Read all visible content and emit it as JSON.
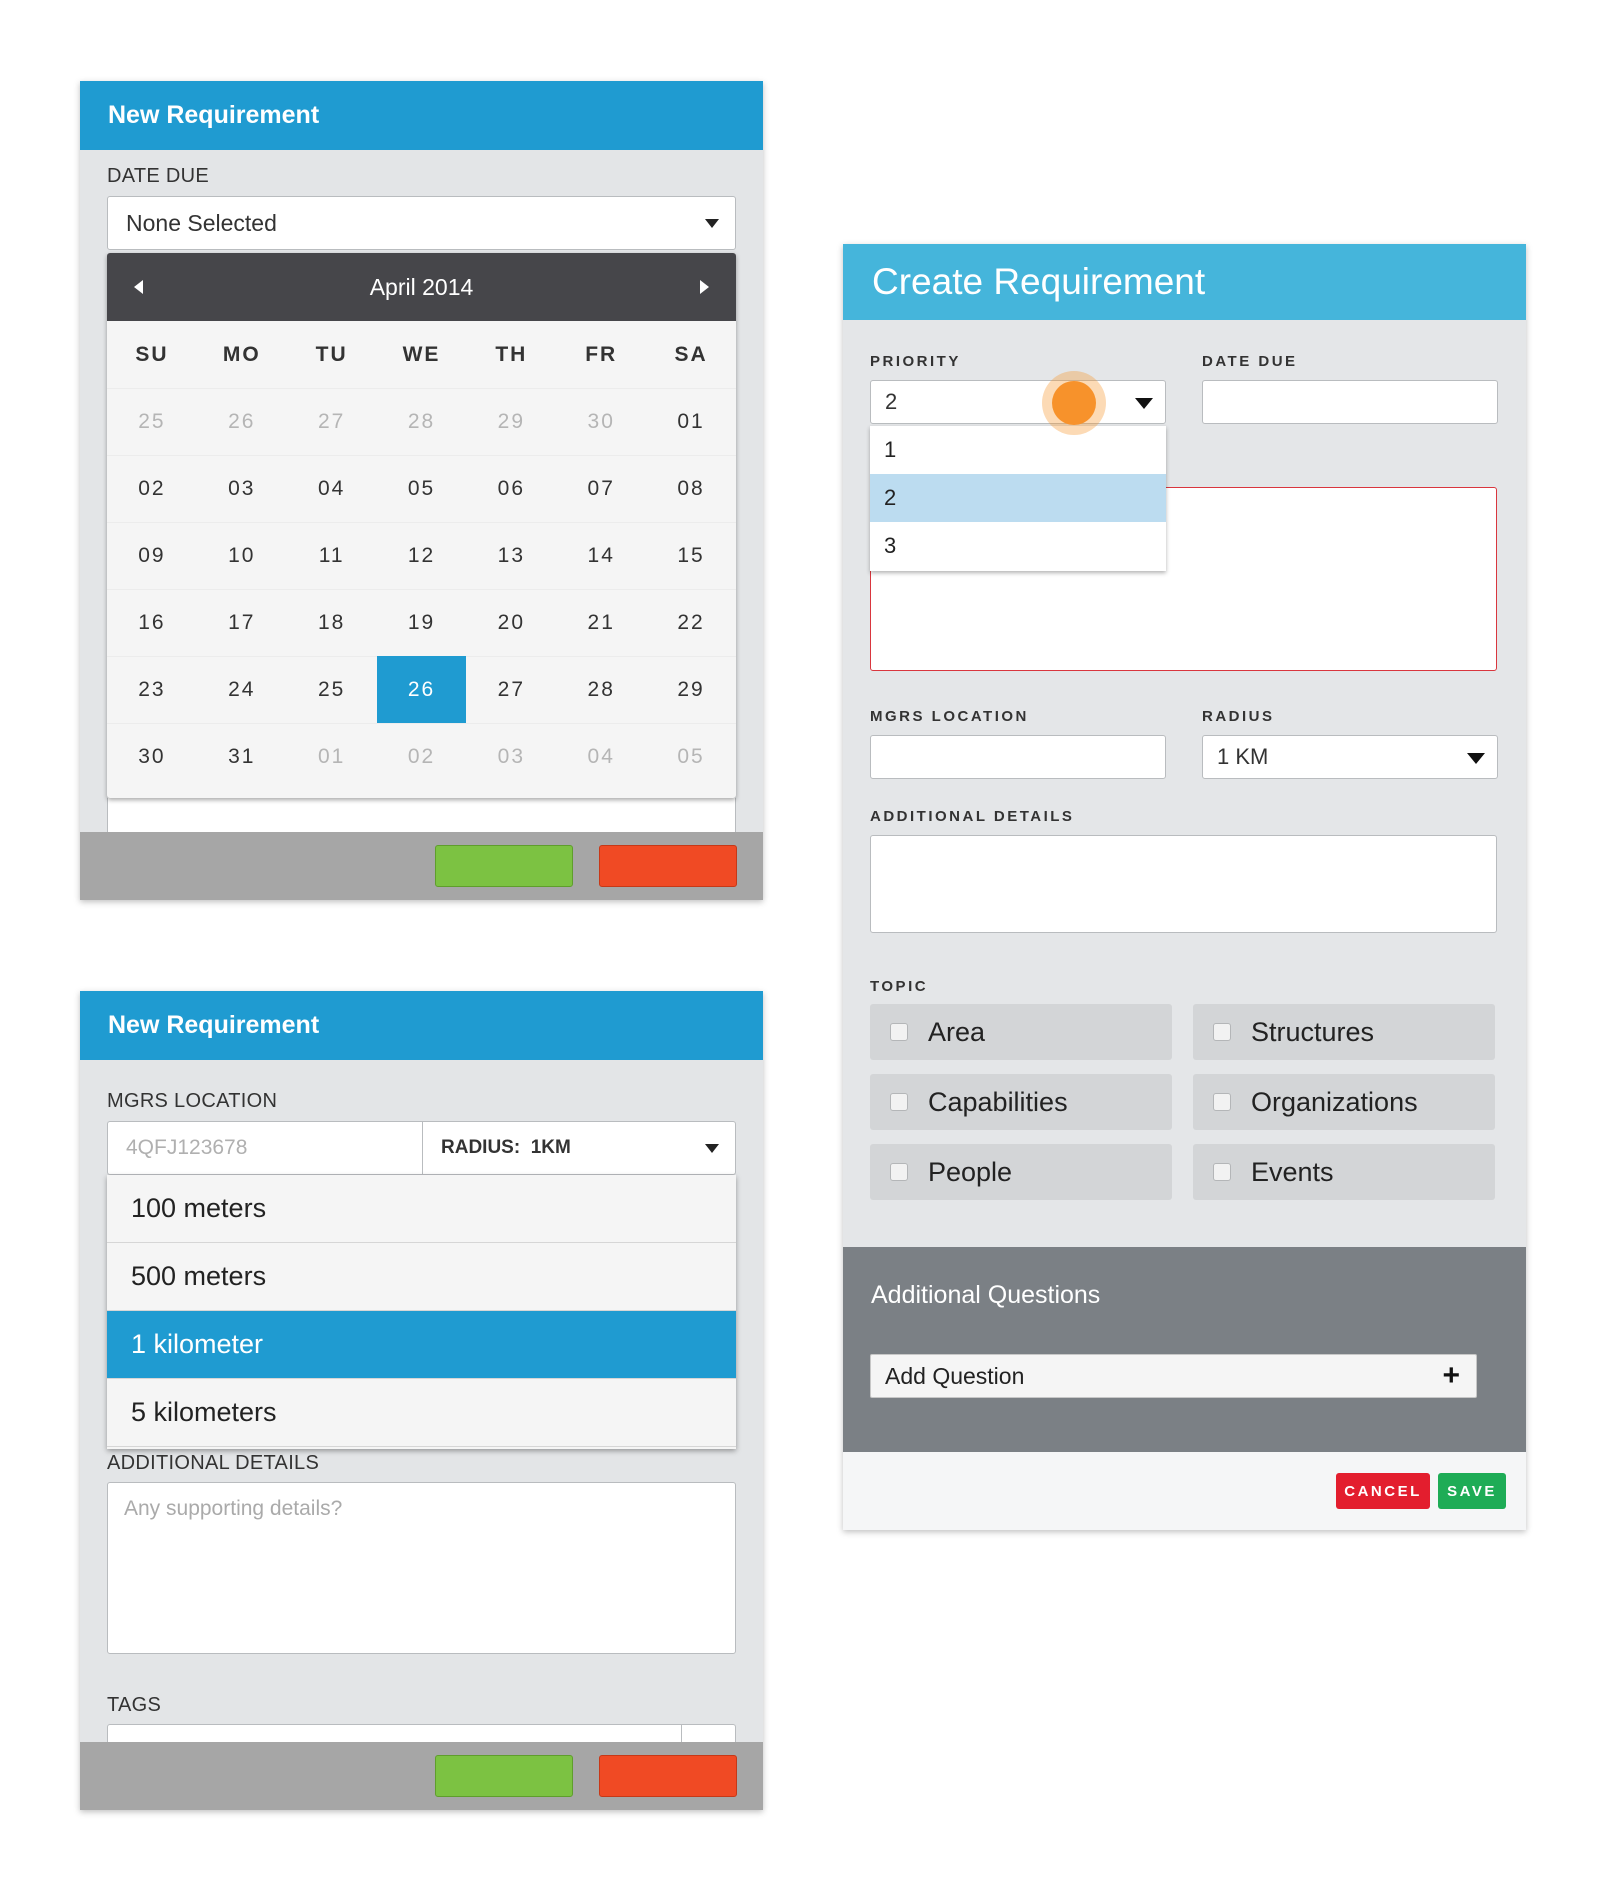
{
  "panel1": {
    "title": "New Requirement",
    "date_due_label": "DATE DUE",
    "date_select_value": "None Selected",
    "calendar": {
      "month_label": "April 2014",
      "weekdays": [
        "SU",
        "MO",
        "TU",
        "WE",
        "TH",
        "FR",
        "SA"
      ],
      "days": [
        {
          "d": "25",
          "muted": true
        },
        {
          "d": "26",
          "muted": true
        },
        {
          "d": "27",
          "muted": true
        },
        {
          "d": "28",
          "muted": true
        },
        {
          "d": "29",
          "muted": true
        },
        {
          "d": "30",
          "muted": true
        },
        {
          "d": "01",
          "muted": false
        },
        {
          "d": "02",
          "muted": false
        },
        {
          "d": "03",
          "muted": false
        },
        {
          "d": "04",
          "muted": false
        },
        {
          "d": "05",
          "muted": false
        },
        {
          "d": "06",
          "muted": false
        },
        {
          "d": "07",
          "muted": false
        },
        {
          "d": "08",
          "muted": false
        },
        {
          "d": "09",
          "muted": false
        },
        {
          "d": "10",
          "muted": false
        },
        {
          "d": "11",
          "muted": false
        },
        {
          "d": "12",
          "muted": false
        },
        {
          "d": "13",
          "muted": false
        },
        {
          "d": "14",
          "muted": false
        },
        {
          "d": "15",
          "muted": false
        },
        {
          "d": "16",
          "muted": false
        },
        {
          "d": "17",
          "muted": false
        },
        {
          "d": "18",
          "muted": false
        },
        {
          "d": "19",
          "muted": false
        },
        {
          "d": "20",
          "muted": false
        },
        {
          "d": "21",
          "muted": false
        },
        {
          "d": "22",
          "muted": false
        },
        {
          "d": "23",
          "muted": false
        },
        {
          "d": "24",
          "muted": false
        },
        {
          "d": "25",
          "muted": false
        },
        {
          "d": "26",
          "muted": false,
          "selected": true
        },
        {
          "d": "27",
          "muted": false
        },
        {
          "d": "28",
          "muted": false
        },
        {
          "d": "29",
          "muted": false
        },
        {
          "d": "30",
          "muted": false
        },
        {
          "d": "31",
          "muted": false
        },
        {
          "d": "01",
          "muted": true
        },
        {
          "d": "02",
          "muted": true
        },
        {
          "d": "03",
          "muted": true
        },
        {
          "d": "04",
          "muted": true
        },
        {
          "d": "05",
          "muted": true
        }
      ]
    }
  },
  "panel2": {
    "title": "New Requirement",
    "mgrs_label": "MGRS LOCATION",
    "mgrs_placeholder": "4QFJ123678",
    "radius_select_value": "RADIUS:  1KM",
    "radius_options": [
      "100 meters",
      "500 meters",
      "1 kilometer",
      "5 kilometers"
    ],
    "radius_selected_index": 2,
    "details_label": "ADDITIONAL DETAILS",
    "details_placeholder": "Any supporting details?",
    "tags_label": "TAGS"
  },
  "panel3": {
    "title": "Create Requirement",
    "priority_label": "PRIORITY",
    "priority_value": "2",
    "priority_options": [
      "1",
      "2",
      "3"
    ],
    "priority_selected_index": 1,
    "date_due_label": "DATE DUE",
    "mgrs_label": "MGRS LOCATION",
    "radius_label": "RADIUS",
    "radius_value": "1 KM",
    "details_label": "ADDITIONAL DETAILS",
    "topic_label": "TOPIC",
    "topics": [
      "Area",
      "Structures",
      "Capabilities",
      "Organizations",
      "People",
      "Events"
    ],
    "additional_questions_title": "Additional Questions",
    "add_question_label": "Add Question",
    "add_icon_glyph": "+",
    "cancel_label": "CANCEL",
    "save_label": "SAVE"
  },
  "colors": {
    "header_blue": "#1f9bd1",
    "header_light_blue": "#45b5db",
    "confirm_green": "#7cc242",
    "dismiss_red": "#f04a24",
    "cancel_red": "#e31e2e",
    "save_green": "#1eac56",
    "touch_orange": "#f7922b",
    "error_border": "#d9363e"
  },
  "icons": {
    "prev_month": "caret-left-icon",
    "next_month": "caret-right-icon",
    "dropdown": "caret-down-icon",
    "touch_indicator": "touch-indicator-icon",
    "add": "plus-icon",
    "checkbox": "checkbox-icon"
  }
}
